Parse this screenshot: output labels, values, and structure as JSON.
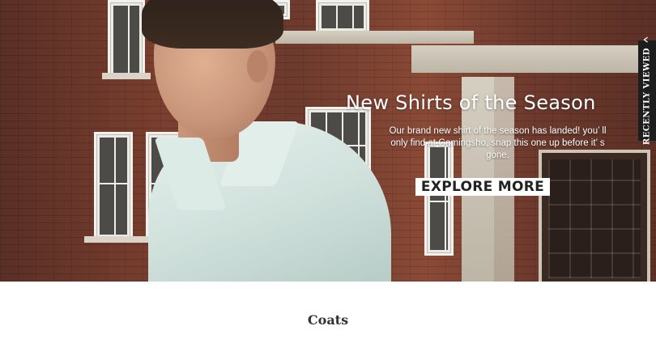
{
  "hero": {
    "title": "New Shirts of the Season",
    "subtitle": "Our brand new shirt of the season has landed! you’ ll only find at Gamingsho, snap this one up before it’ s gone.",
    "cta_label": "EXPLORE MORE"
  },
  "recently_viewed": {
    "label": "RECENTLY VIEWED",
    "icon": "chevron-up-icon"
  },
  "section": {
    "title": "Coats"
  }
}
